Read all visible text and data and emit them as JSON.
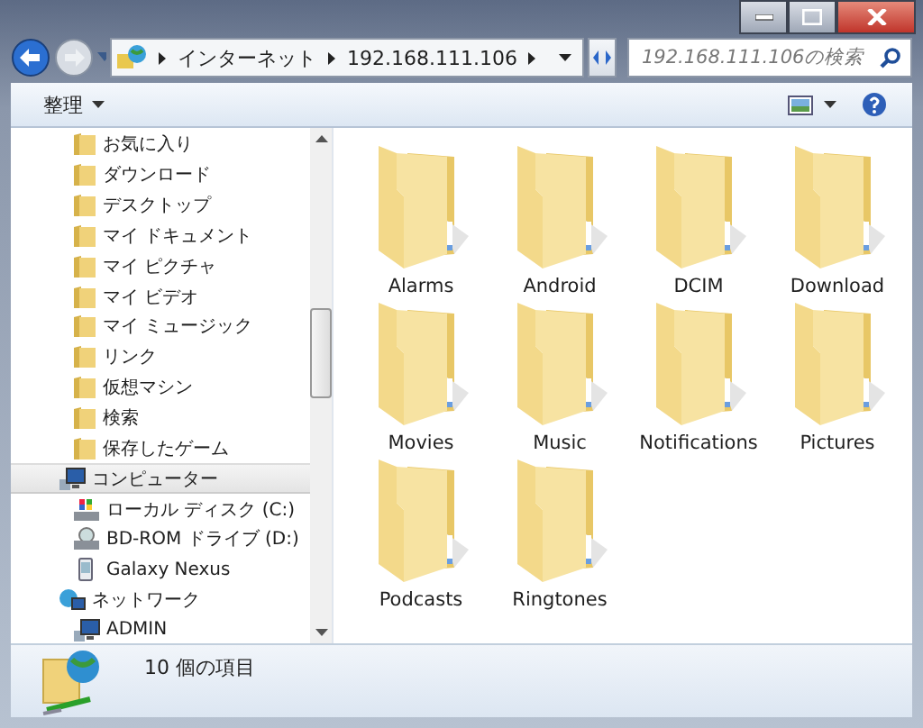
{
  "address": {
    "crumbs": [
      "インターネット",
      "192.168.111.106"
    ]
  },
  "search": {
    "placeholder": "192.168.111.106の検索"
  },
  "toolbar": {
    "organize": "整理"
  },
  "sidebar": {
    "items": [
      {
        "label": "お気に入り",
        "kind": "folder",
        "selected": false
      },
      {
        "label": "ダウンロード",
        "kind": "folder",
        "selected": false
      },
      {
        "label": "デスクトップ",
        "kind": "folder",
        "selected": false
      },
      {
        "label": "マイ ドキュメント",
        "kind": "folder",
        "selected": false
      },
      {
        "label": "マイ ピクチャ",
        "kind": "folder",
        "selected": false
      },
      {
        "label": "マイ ビデオ",
        "kind": "folder",
        "selected": false
      },
      {
        "label": "マイ ミュージック",
        "kind": "folder",
        "selected": false
      },
      {
        "label": "リンク",
        "kind": "folder",
        "selected": false
      },
      {
        "label": "仮想マシン",
        "kind": "folder",
        "selected": false
      },
      {
        "label": "検索",
        "kind": "folder",
        "selected": false
      },
      {
        "label": "保存したゲーム",
        "kind": "folder",
        "selected": false
      },
      {
        "label": "コンピューター",
        "kind": "computer",
        "selected": true,
        "children": [
          {
            "label": "ローカル ディスク (C:)",
            "kind": "disk",
            "selected": false
          },
          {
            "label": "BD-ROM ドライブ (D:)",
            "kind": "optical",
            "selected": false
          },
          {
            "label": "Galaxy Nexus",
            "kind": "phone",
            "selected": false
          }
        ]
      },
      {
        "label": "ネットワーク",
        "kind": "network",
        "selected": false,
        "children": [
          {
            "label": "ADMIN",
            "kind": "computer",
            "selected": false
          }
        ]
      }
    ]
  },
  "folders": [
    {
      "name": "Alarms"
    },
    {
      "name": "Android"
    },
    {
      "name": "DCIM"
    },
    {
      "name": "Download"
    },
    {
      "name": "Movies"
    },
    {
      "name": "Music"
    },
    {
      "name": "Notifications"
    },
    {
      "name": "Pictures"
    },
    {
      "name": "Podcasts"
    },
    {
      "name": "Ringtones"
    }
  ],
  "status_bar": {
    "count": "10 個の項目"
  }
}
